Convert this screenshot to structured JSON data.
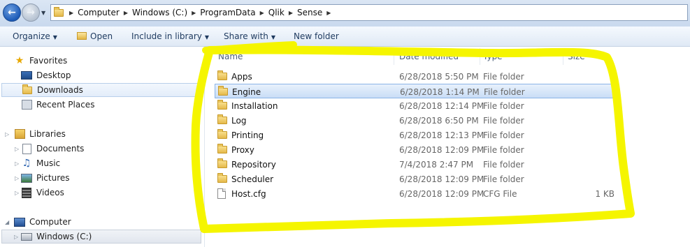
{
  "address": {
    "crumbs": [
      "Computer",
      "Windows (C:)",
      "ProgramData",
      "Qlik",
      "Sense"
    ]
  },
  "toolbar": {
    "organize": "Organize",
    "open": "Open",
    "include": "Include in library",
    "share": "Share with",
    "new_folder": "New folder"
  },
  "nav": {
    "favorites": "Favorites",
    "desktop": "Desktop",
    "downloads": "Downloads",
    "recent": "Recent Places",
    "libraries": "Libraries",
    "documents": "Documents",
    "music": "Music",
    "pictures": "Pictures",
    "videos": "Videos",
    "computer": "Computer",
    "drive_c": "Windows (C:)"
  },
  "columns": {
    "name": "Name",
    "date": "Date modified",
    "type": "Type",
    "size": "Size"
  },
  "files": [
    {
      "name": "Apps",
      "date": "6/28/2018 5:50 PM",
      "type": "File folder",
      "size": ""
    },
    {
      "name": "Engine",
      "date": "6/28/2018 1:14 PM",
      "type": "File folder",
      "size": ""
    },
    {
      "name": "Installation",
      "date": "6/28/2018 12:14 PM",
      "type": "File folder",
      "size": ""
    },
    {
      "name": "Log",
      "date": "6/28/2018 6:50 PM",
      "type": "File folder",
      "size": ""
    },
    {
      "name": "Printing",
      "date": "6/28/2018 12:13 PM",
      "type": "File folder",
      "size": ""
    },
    {
      "name": "Proxy",
      "date": "6/28/2018 12:09 PM",
      "type": "File folder",
      "size": ""
    },
    {
      "name": "Repository",
      "date": "7/4/2018 2:47 PM",
      "type": "File folder",
      "size": ""
    },
    {
      "name": "Scheduler",
      "date": "6/28/2018 12:09 PM",
      "type": "File folder",
      "size": ""
    },
    {
      "name": "Host.cfg",
      "date": "6/28/2018 12:09 PM",
      "type": "CFG File",
      "size": "1 KB"
    }
  ],
  "colors": {
    "highlight": "#f5f500",
    "selection": "#cce0f7"
  }
}
